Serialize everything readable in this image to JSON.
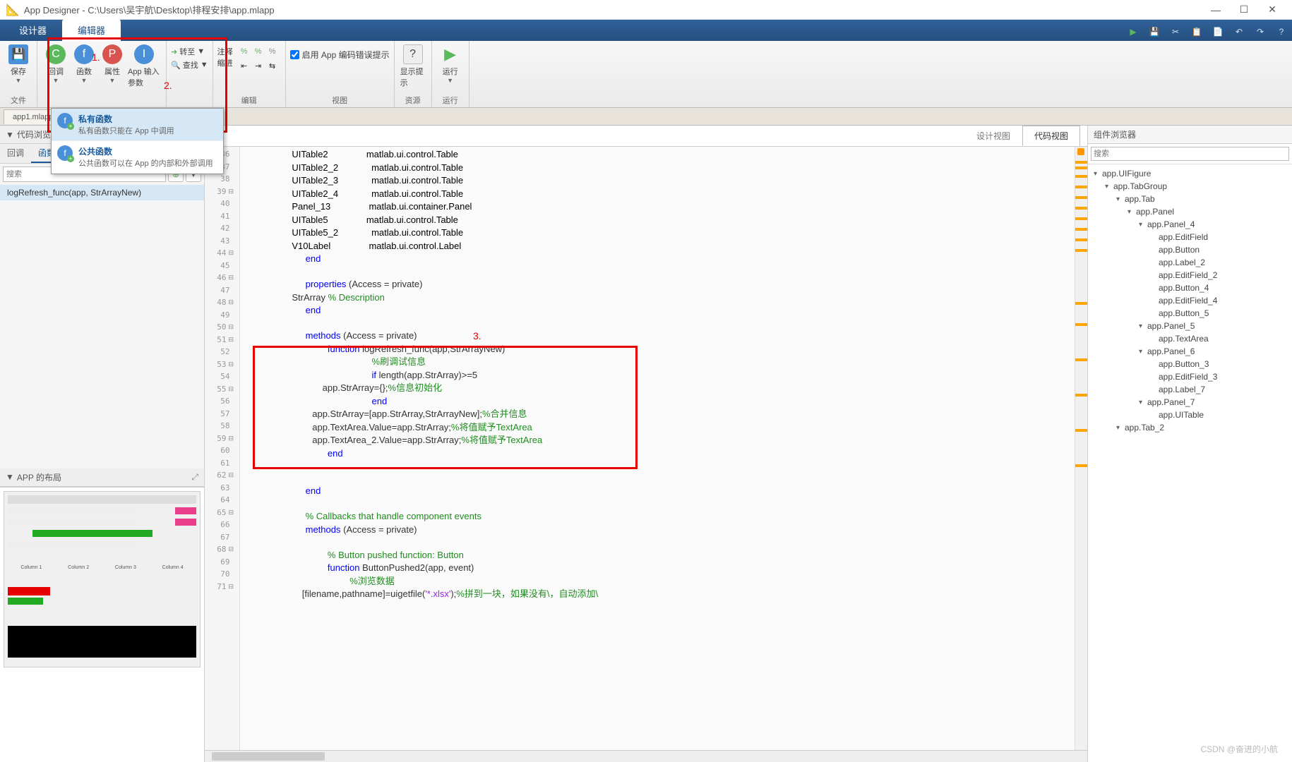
{
  "titlebar": {
    "title": "App Designer - C:\\Users\\吴宇航\\Desktop\\排程安排\\app.mlapp"
  },
  "tabs": {
    "designer": "设计器",
    "editor": "编辑器"
  },
  "ribbon": {
    "save": "保存",
    "callback": "回调",
    "func": "函数",
    "prop": "属性",
    "appinput": "App 输入参数",
    "goto": "转至",
    "find": "查找",
    "comment": "注释",
    "indent": "缩进",
    "enablecheck": "启用 App 编码错误提示",
    "showtips": "显示提示",
    "run": "运行",
    "g_file": "文件",
    "g_edit": "编辑",
    "g_view": "视图",
    "g_res": "资源",
    "g_run": "运行"
  },
  "anno": {
    "a1": "1.",
    "a2": "2.",
    "a3": "3."
  },
  "filetab": "app1.mlapp",
  "dropdown": {
    "priv_t": "私有函数",
    "priv_d": "私有函数只能在 App 中调用",
    "pub_t": "公共函数",
    "pub_d": "公共函数可以在 App 的内部和外部调用"
  },
  "left": {
    "browser": "代码浏览",
    "cb": "回调",
    "fn": "函数",
    "search": "搜索",
    "func1": "logRefresh_func(app, StrArrayNew)",
    "layout": "APP 的布局"
  },
  "view": {
    "design": "设计视图",
    "code": "代码视图"
  },
  "code": {
    "l36": "            UITable2               matlab.ui.control.Table",
    "l37": "            UITable2_2             matlab.ui.control.Table",
    "l38": "            UITable2_3             matlab.ui.control.Table",
    "l39": "            UITable2_4             matlab.ui.control.Table",
    "l40": "            Panel_13               matlab.ui.container.Panel",
    "l41": "            UITable5               matlab.ui.control.Table",
    "l42": "            UITable5_2             matlab.ui.control.Table",
    "l43": "            V10Label               matlab.ui.control.Label",
    "l44_kw": "end",
    "l46_kw": "properties",
    "l46_rest": " (Access = private)",
    "l47a": "            StrArray ",
    "l47c": "% Description",
    "l48_kw": "end",
    "l50_kw": "methods",
    "l50_rest": " (Access = private)",
    "l51_kw": "function",
    "l51_rest": " logRefresh_func(app,StrArrayNew)",
    "l52c": "%刷调试信息",
    "l53_kw": "if",
    "l53_rest": " length(app.StrArray)>=5",
    "l54a": "                        app.StrArray={};",
    "l54c": "%信息初始化",
    "l55_kw": "end",
    "l56a": "                    app.StrArray=[app.StrArray,StrArrayNew];",
    "l56c": "%合并信息",
    "l57a": "                    app.TextArea.Value=app.StrArray;",
    "l57c": "%将值赋予TextArea",
    "l58a": "                    app.TextArea_2.Value=app.StrArray;",
    "l58c": "%将值赋予TextArea",
    "l59_kw": "end",
    "l62_kw": "end",
    "l64c": "% Callbacks that handle component events",
    "l65_kw": "methods",
    "l65_rest": " (Access = private)",
    "l67c": "% Button pushed function: Button",
    "l68_kw": "function",
    "l68_rest": " ButtonPushed2(app, event)",
    "l69c": "%浏览数据",
    "l70a": "                [filename,pathname]=uigetfile(",
    "l70s": "'*.xlsx'",
    "l70b": ");",
    "l70c": "%拼到一块，如果没有\\，自动添加\\"
  },
  "lines": [
    36,
    37,
    38,
    39,
    40,
    41,
    42,
    43,
    44,
    45,
    46,
    47,
    48,
    49,
    50,
    51,
    52,
    53,
    54,
    55,
    56,
    57,
    58,
    59,
    60,
    61,
    62,
    63,
    64,
    65,
    66,
    67,
    68,
    69,
    70,
    71
  ],
  "right": {
    "title": "组件浏览器",
    "search": "搜索",
    "tree": [
      {
        "l": 0,
        "t": "app.UIFigure",
        "e": 1
      },
      {
        "l": 1,
        "t": "app.TabGroup",
        "e": 1
      },
      {
        "l": 2,
        "t": "app.Tab",
        "e": 1
      },
      {
        "l": 3,
        "t": "app.Panel",
        "e": 1
      },
      {
        "l": 4,
        "t": "app.Panel_4",
        "e": 1
      },
      {
        "l": 5,
        "t": "app.EditField",
        "e": 0
      },
      {
        "l": 5,
        "t": "app.Button",
        "e": 0
      },
      {
        "l": 5,
        "t": "app.Label_2",
        "e": 0
      },
      {
        "l": 5,
        "t": "app.EditField_2",
        "e": 0
      },
      {
        "l": 5,
        "t": "app.Button_4",
        "e": 0
      },
      {
        "l": 5,
        "t": "app.EditField_4",
        "e": 0
      },
      {
        "l": 5,
        "t": "app.Button_5",
        "e": 0
      },
      {
        "l": 4,
        "t": "app.Panel_5",
        "e": 1
      },
      {
        "l": 5,
        "t": "app.TextArea",
        "e": 0
      },
      {
        "l": 4,
        "t": "app.Panel_6",
        "e": 1
      },
      {
        "l": 5,
        "t": "app.Button_3",
        "e": 0
      },
      {
        "l": 5,
        "t": "app.EditField_3",
        "e": 0
      },
      {
        "l": 5,
        "t": "app.Label_7",
        "e": 0
      },
      {
        "l": 4,
        "t": "app.Panel_7",
        "e": 1
      },
      {
        "l": 5,
        "t": "app.UITable",
        "e": 0
      },
      {
        "l": 2,
        "t": "app.Tab_2",
        "e": 1
      }
    ]
  },
  "watermark": "CSDN @奋进的小航"
}
